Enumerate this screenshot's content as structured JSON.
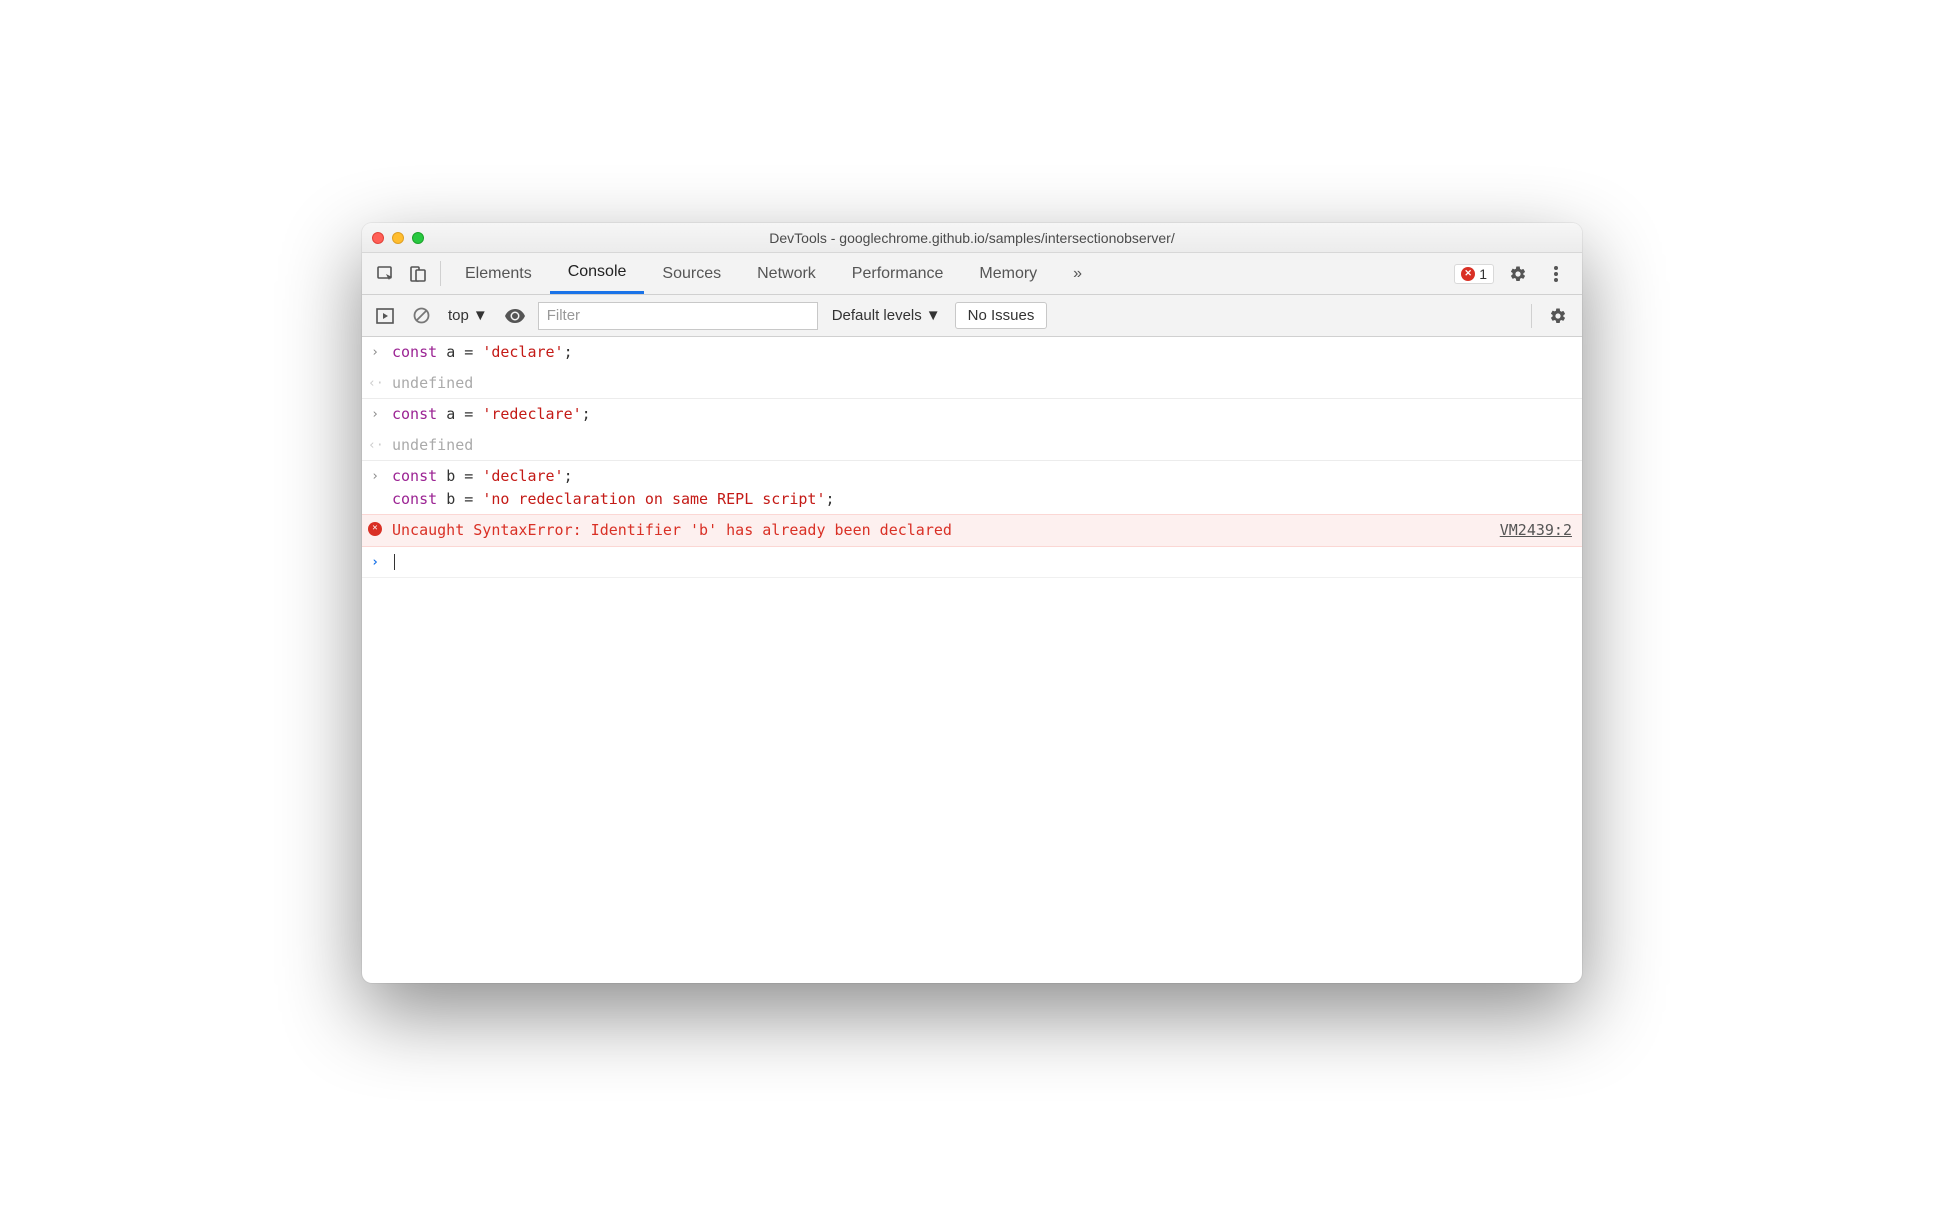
{
  "window": {
    "title": "DevTools - googlechrome.github.io/samples/intersectionobserver/"
  },
  "tabs": {
    "elements": "Elements",
    "console": "Console",
    "sources": "Sources",
    "network": "Network",
    "performance": "Performance",
    "memory": "Memory",
    "more": "»",
    "error_count": "1"
  },
  "toolbar": {
    "context": "top",
    "filter_placeholder": "Filter",
    "levels": "Default levels",
    "issues": "No Issues"
  },
  "console": {
    "rows": [
      {
        "type": "input",
        "tokens": [
          {
            "t": "kw",
            "v": "const"
          },
          {
            "t": "sp"
          },
          {
            "t": "ident",
            "v": "a"
          },
          {
            "t": "sp"
          },
          {
            "t": "op",
            "v": "="
          },
          {
            "t": "sp"
          },
          {
            "t": "str",
            "v": "'declare'"
          },
          {
            "t": "op",
            "v": ";"
          }
        ]
      },
      {
        "type": "result",
        "text": "undefined"
      },
      {
        "type": "input",
        "tokens": [
          {
            "t": "kw",
            "v": "const"
          },
          {
            "t": "sp"
          },
          {
            "t": "ident",
            "v": "a"
          },
          {
            "t": "sp"
          },
          {
            "t": "op",
            "v": "="
          },
          {
            "t": "sp"
          },
          {
            "t": "str",
            "v": "'redeclare'"
          },
          {
            "t": "op",
            "v": ";"
          }
        ]
      },
      {
        "type": "result",
        "text": "undefined"
      },
      {
        "type": "input-multi",
        "lines": [
          [
            {
              "t": "kw",
              "v": "const"
            },
            {
              "t": "sp"
            },
            {
              "t": "ident",
              "v": "b"
            },
            {
              "t": "sp"
            },
            {
              "t": "op",
              "v": "="
            },
            {
              "t": "sp"
            },
            {
              "t": "str",
              "v": "'declare'"
            },
            {
              "t": "op",
              "v": ";"
            }
          ],
          [
            {
              "t": "kw",
              "v": "const"
            },
            {
              "t": "sp"
            },
            {
              "t": "ident",
              "v": "b"
            },
            {
              "t": "sp"
            },
            {
              "t": "op",
              "v": "="
            },
            {
              "t": "sp"
            },
            {
              "t": "str",
              "v": "'no redeclaration on same REPL script'"
            },
            {
              "t": "op",
              "v": ";"
            }
          ]
        ]
      },
      {
        "type": "error",
        "text": "Uncaught SyntaxError: Identifier 'b' has already been declared",
        "source": "VM2439:2"
      },
      {
        "type": "prompt"
      }
    ]
  }
}
